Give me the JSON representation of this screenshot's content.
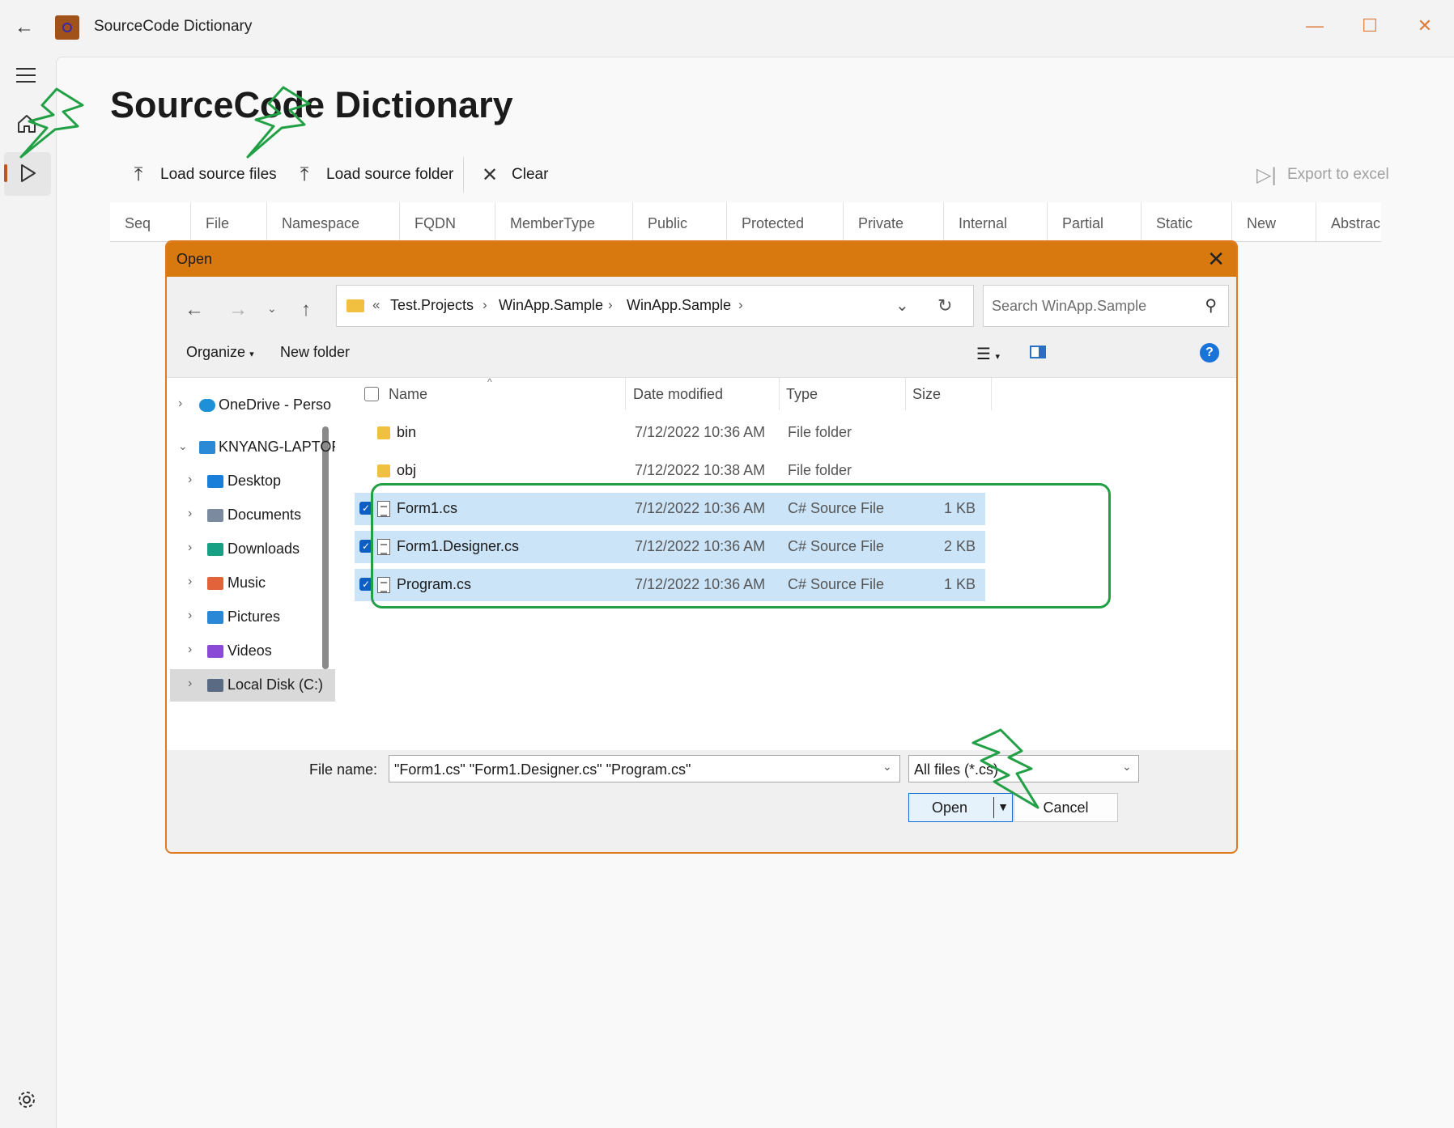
{
  "window": {
    "title": "SourceCode Dictionary",
    "back_glyph": "←",
    "minimize_glyph": "—",
    "maximize_glyph": "☐",
    "close_glyph": "✕"
  },
  "page": {
    "title": "SourceCode Dictionary"
  },
  "commands": {
    "load_files": "Load source files",
    "load_folder": "Load source folder",
    "clear": "Clear",
    "export": "Export to excel"
  },
  "grid": {
    "columns": [
      "Seq",
      "File",
      "Namespace",
      "FQDN",
      "MemberType",
      "Public",
      "Protected",
      "Private",
      "Internal",
      "Partial",
      "Static",
      "New",
      "Abstrac"
    ]
  },
  "dialog": {
    "title": "Open",
    "breadcrumb": [
      "Test.Projects",
      "WinApp.Sample",
      "WinApp.Sample"
    ],
    "search_placeholder": "Search WinApp.Sample",
    "organize": "Organize",
    "new_folder": "New folder",
    "help": "?",
    "tree": [
      {
        "label": "OneDrive - Perso",
        "icon": "cloud-icon",
        "color": "#1e90d8"
      },
      {
        "label": "KNYANG-LAPTOF",
        "icon": "computer-icon",
        "color": "#2a8ad6"
      },
      {
        "label": "Desktop",
        "icon": "desktop-icon",
        "color": "#1a7fd8"
      },
      {
        "label": "Documents",
        "icon": "documents-icon",
        "color": "#7c8aa0"
      },
      {
        "label": "Downloads",
        "icon": "downloads-icon",
        "color": "#18a085"
      },
      {
        "label": "Music",
        "icon": "music-icon",
        "color": "#e2623a"
      },
      {
        "label": "Pictures",
        "icon": "pictures-icon",
        "color": "#2a88d6"
      },
      {
        "label": "Videos",
        "icon": "videos-icon",
        "color": "#8a4ad6"
      },
      {
        "label": "Local Disk (C:)",
        "icon": "disk-icon",
        "color": "#5a6a82"
      }
    ],
    "file_columns": {
      "name": "Name",
      "date": "Date modified",
      "type": "Type",
      "size": "Size"
    },
    "files": [
      {
        "name": "bin",
        "date": "7/12/2022 10:36 AM",
        "type": "File folder",
        "size": "",
        "selected": false
      },
      {
        "name": "obj",
        "date": "7/12/2022 10:38 AM",
        "type": "File folder",
        "size": "",
        "selected": false
      },
      {
        "name": "Form1.cs",
        "date": "7/12/2022 10:36 AM",
        "type": "C# Source File",
        "size": "1 KB",
        "selected": true
      },
      {
        "name": "Form1.Designer.cs",
        "date": "7/12/2022 10:36 AM",
        "type": "C# Source File",
        "size": "2 KB",
        "selected": true
      },
      {
        "name": "Program.cs",
        "date": "7/12/2022 10:36 AM",
        "type": "C# Source File",
        "size": "1 KB",
        "selected": true
      }
    ],
    "file_name_label": "File name:",
    "file_name_value": "\"Form1.cs\" \"Form1.Designer.cs\" \"Program.cs\"",
    "filter_value": "All files (*.cs)",
    "open_label": "Open",
    "cancel_label": "Cancel"
  },
  "colors": {
    "accent": "#d87910",
    "selection": "#cce4f7",
    "highlight": "#22a045"
  }
}
